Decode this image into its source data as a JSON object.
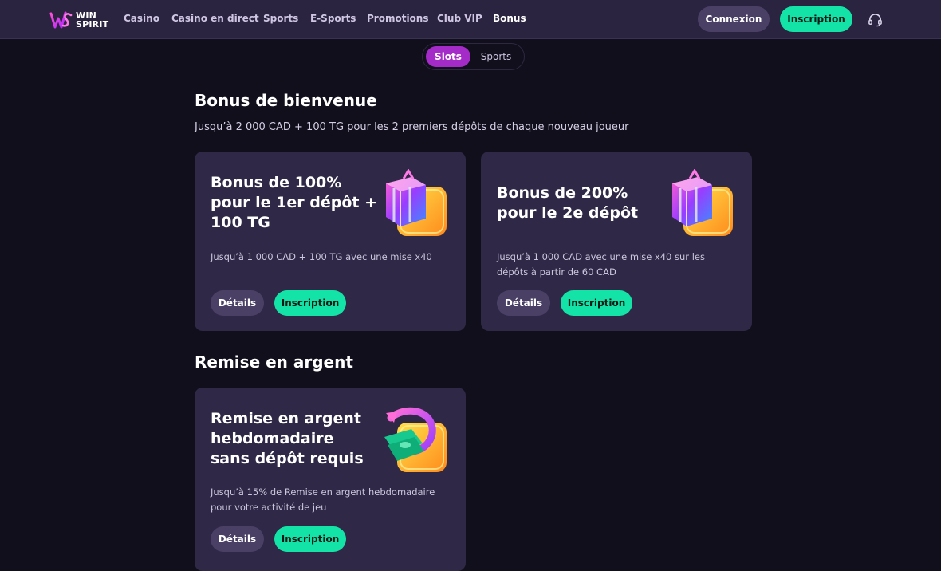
{
  "header": {
    "logo_line1": "WIN",
    "logo_line2": "SPIRIT",
    "nav": [
      "Casino",
      "Casino en direct",
      "Sports",
      "E-Sports",
      "Promotions",
      "Club VIP",
      "Bonus"
    ],
    "active_nav": "Bonus",
    "login_label": "Connexion",
    "signup_label": "Inscription",
    "support_icon": "headset-icon"
  },
  "toggle": {
    "options": [
      "Slots",
      "Sports"
    ],
    "selected": "Slots"
  },
  "welcome": {
    "title": "Bonus de bienvenue",
    "subtitle": "Jusqu’à 2 000 CAD + 100 TG pour les 2 premiers dépôts de chaque nouveau joueur",
    "cards": [
      {
        "title": "Bonus de 100% pour le 1er dépôt + 100 TG",
        "description": "Jusqu’à 1 000 CAD + 100 TG avec une mise x40",
        "details_label": "Détails",
        "signup_label": "Inscription",
        "art": "gift-box-icon"
      },
      {
        "title": "Bonus de 200% pour le 2e dépôt",
        "description": "Jusqu’à 1 000 CAD avec une mise x40 sur les dépôts à partir de 60 CAD",
        "details_label": "Détails",
        "signup_label": "Inscription",
        "art": "gift-box-icon"
      }
    ]
  },
  "cashback": {
    "title": "Remise en argent",
    "cards": [
      {
        "title": "Remise en argent hebdomadaire sans dépôt requis",
        "description": "Jusqu’à 15% de Remise en argent hebdomadaire pour votre activité de jeu",
        "details_label": "Détails",
        "signup_label": "Inscription",
        "art": "cashback-money-icon"
      }
    ]
  },
  "colors": {
    "page_bg": "#120f1c",
    "header_bg": "#2b2440",
    "card_bg": "#2f2846",
    "accent_green": "#14e3a8",
    "accent_purple": "#a52bc8",
    "secondary_button": "#4a4066"
  }
}
